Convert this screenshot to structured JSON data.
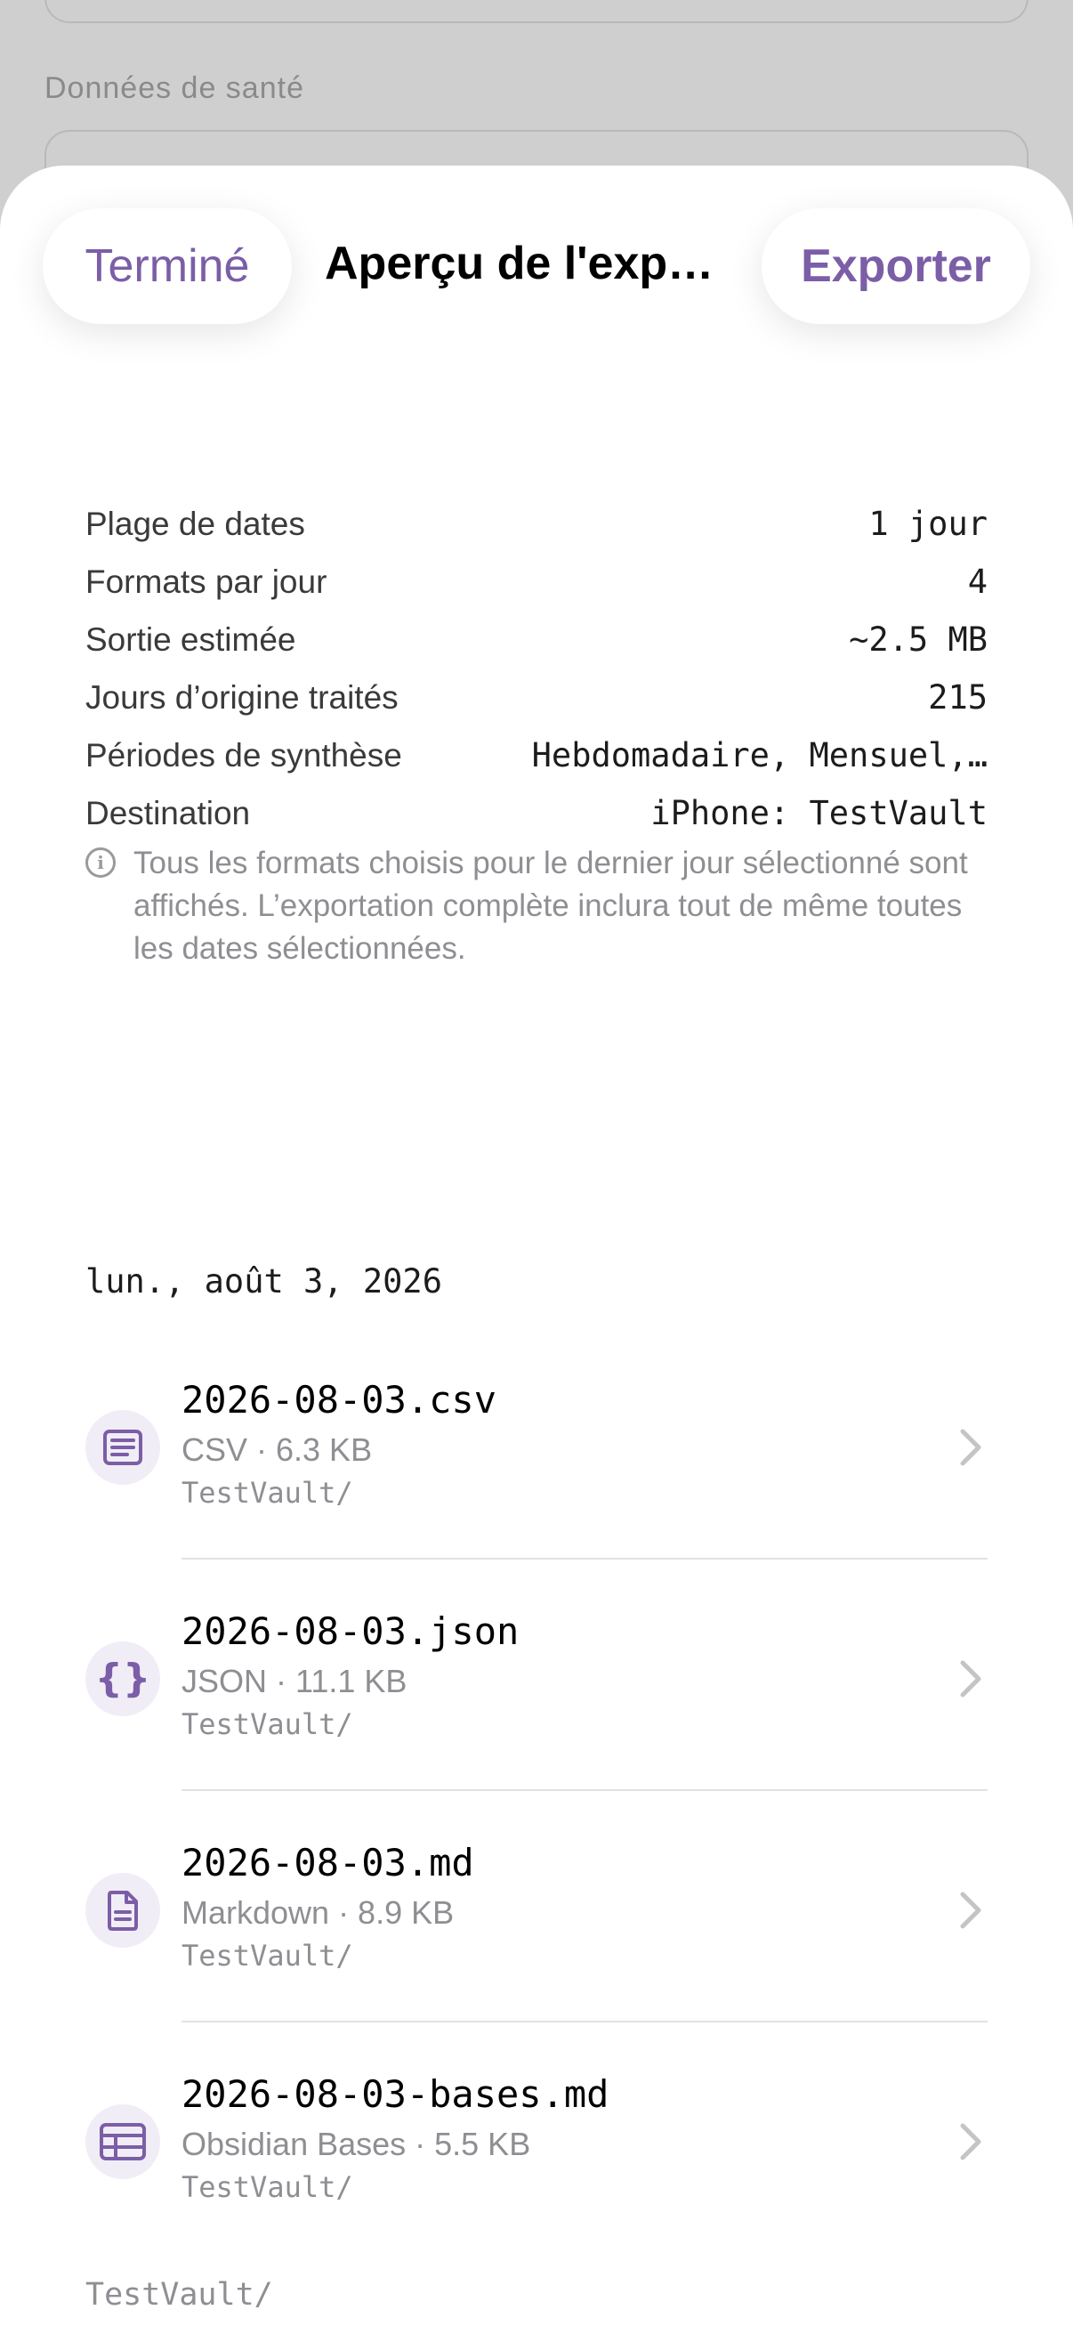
{
  "background": {
    "section_title": "Données de santé"
  },
  "nav": {
    "done_label": "Terminé",
    "title": "Aperçu de l'expo...",
    "export_label": "Exporter"
  },
  "summary": [
    {
      "label": "Plage de dates",
      "value": "1 jour"
    },
    {
      "label": "Formats par jour",
      "value": "4"
    },
    {
      "label": "Sortie estimée",
      "value": "~2.5 MB"
    },
    {
      "label": "Jours d’origine traités",
      "value": "215"
    },
    {
      "label": "Périodes de synthèse",
      "value": "Hebdomadaire, Mensuel,…"
    },
    {
      "label": "Destination",
      "value": "iPhone: TestVault"
    }
  ],
  "note": "Tous les formats choisis pour le dernier jour sélectionné sont affichés. L’exportation complète inclura tout de même toutes les dates sélectionnées.",
  "day_header": "lun., août 3, 2026",
  "files": [
    {
      "name": "2026-08-03.csv",
      "meta": "CSV · 6.3 KB",
      "path": "TestVault/",
      "icon": "list-document-icon"
    },
    {
      "name": "2026-08-03.json",
      "meta": "JSON · 11.1 KB",
      "path": "TestVault/",
      "icon": "curly-braces-icon"
    },
    {
      "name": "2026-08-03.md",
      "meta": "Markdown · 8.9 KB",
      "path": "TestVault/",
      "icon": "text-document-icon"
    },
    {
      "name": "2026-08-03-bases.md",
      "meta": "Obsidian Bases · 5.5 KB",
      "path": "TestVault/",
      "icon": "table-icon"
    }
  ],
  "footer_path": "TestVault/",
  "colors": {
    "accent": "#7b5ea7",
    "icon_bg": "#f1edf6",
    "secondary_text": "#8e8e93"
  }
}
